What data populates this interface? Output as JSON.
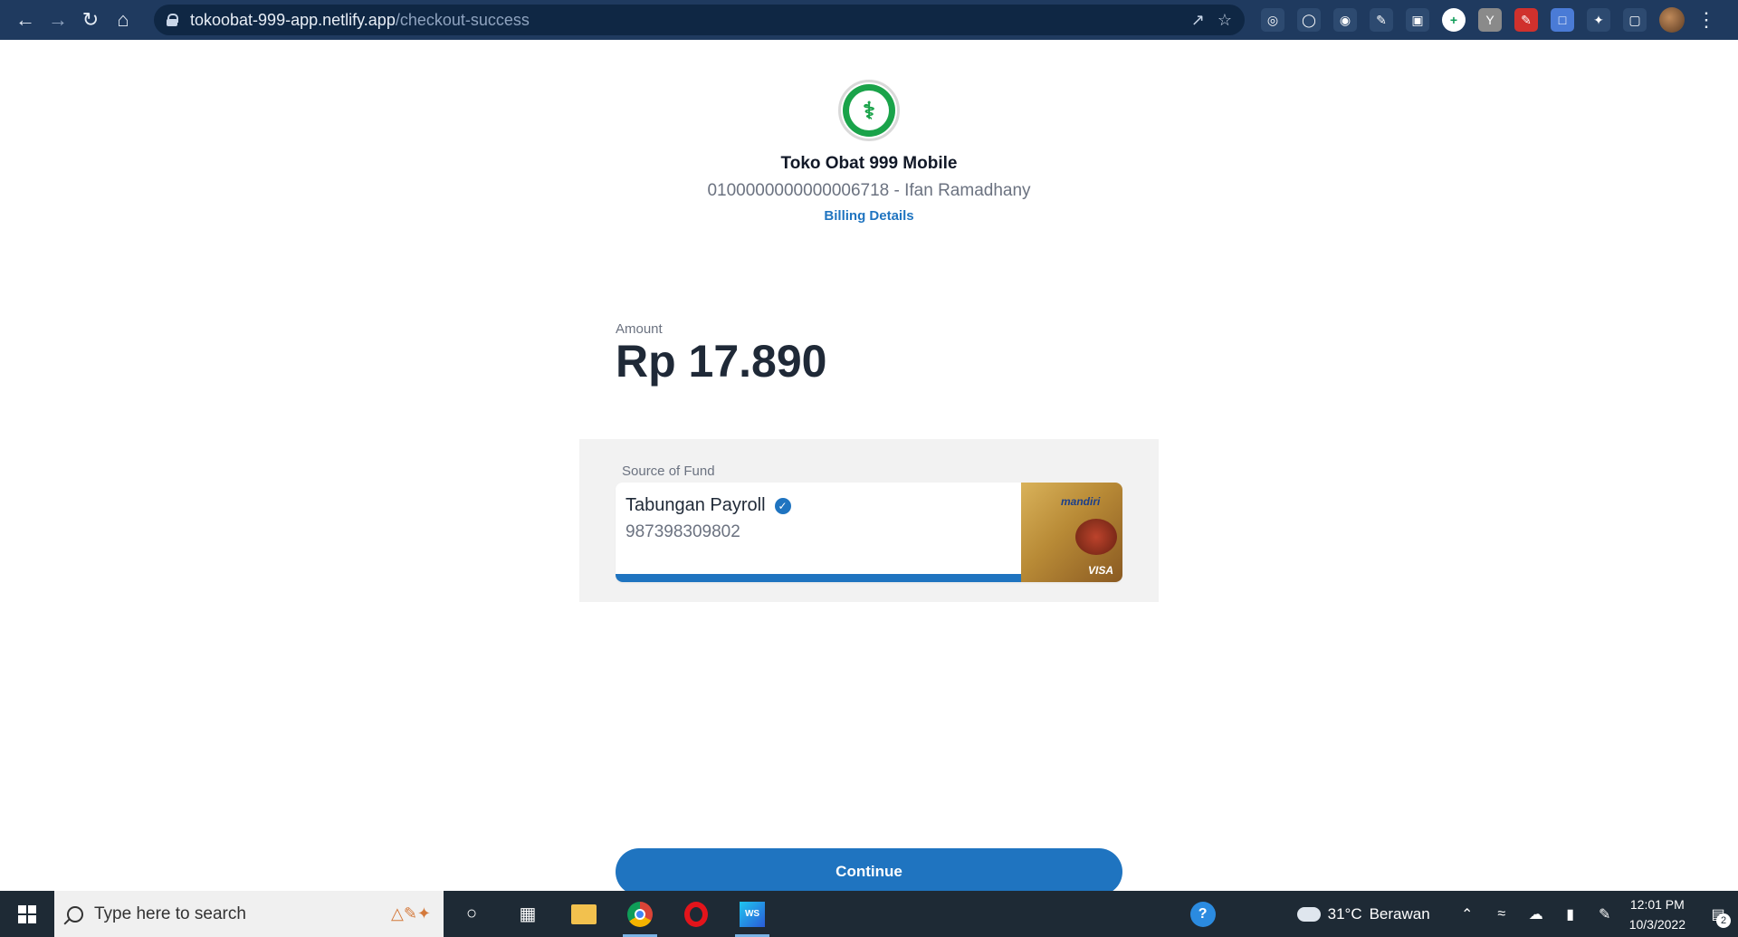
{
  "browser": {
    "url_host": "tokoobat-999-app.netlify.app",
    "url_path": "/checkout-success",
    "nav_icons": [
      "back-icon",
      "forward-icon",
      "reload-icon",
      "home-icon"
    ]
  },
  "merchant": {
    "name": "Toko Obat 999 Mobile",
    "account": "0100000000000006718 - Ifan Ramadhany",
    "billing_link": "Billing Details"
  },
  "payment": {
    "amount_label": "Amount",
    "amount": "Rp 17.890"
  },
  "fund": {
    "label": "Source of Fund",
    "account_name": "Tabungan Payroll",
    "account_number": "987398309802",
    "card_brand": "mandiri",
    "card_network": "VISA"
  },
  "actions": {
    "continue_label": "Continue"
  },
  "taskbar": {
    "search_placeholder": "Type here to search",
    "weather_temp": "31°C",
    "weather_desc": "Berawan",
    "time": "12:01 PM",
    "date": "10/3/2022",
    "notification_count": "2"
  },
  "colors": {
    "accent": "#1f74c0",
    "chrome": "#1f3a5f",
    "logo_green": "#1aa34a"
  }
}
